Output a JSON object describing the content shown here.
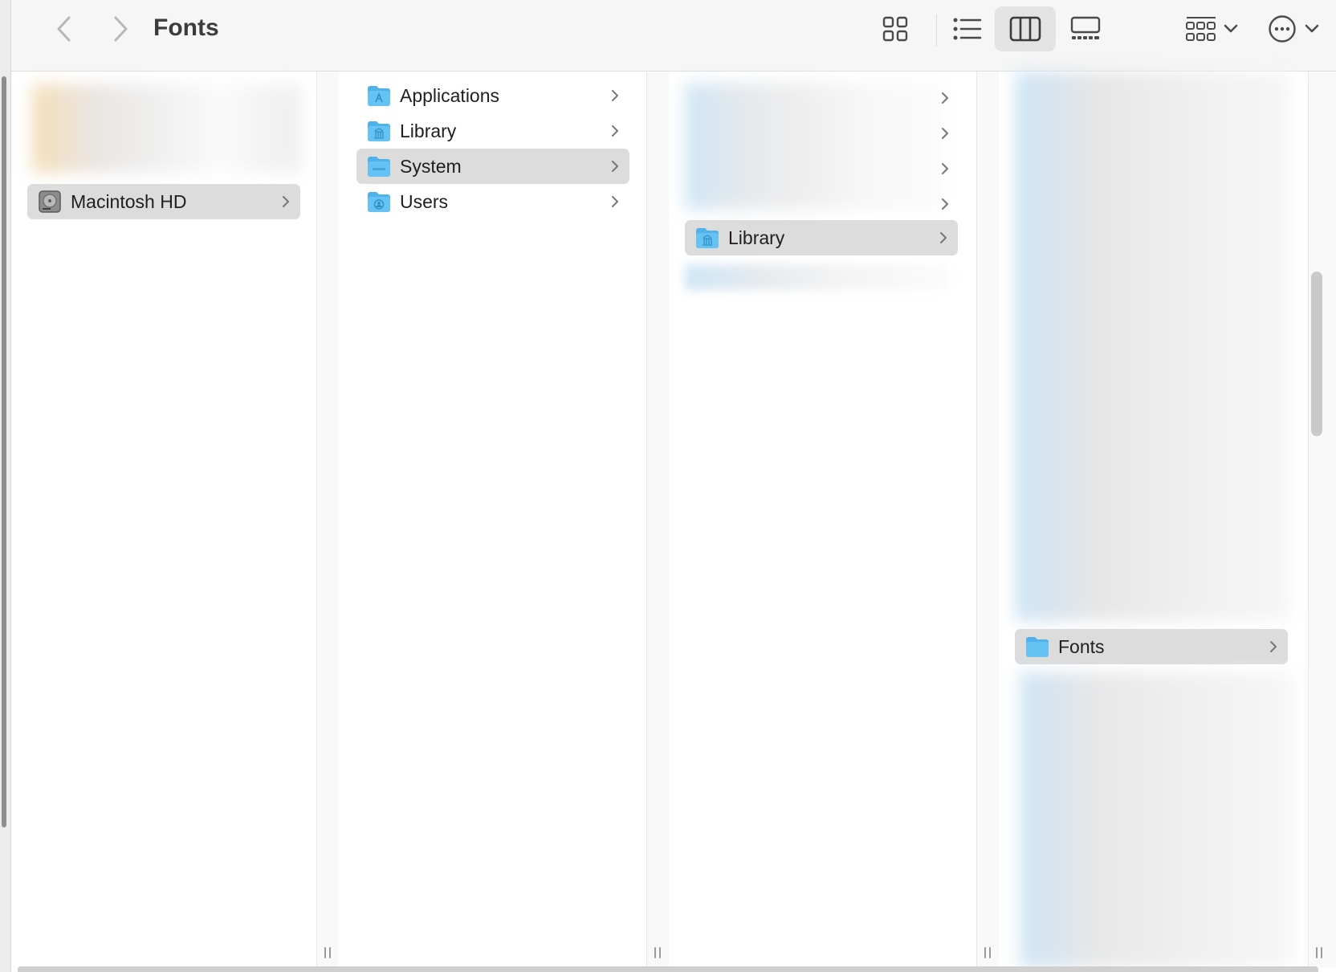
{
  "window": {
    "title": "Fonts"
  },
  "toolbar": {
    "back_icon": "chevron-left-icon",
    "forward_icon": "chevron-right-icon",
    "views": [
      "icon-view-icon",
      "list-view-icon",
      "column-view-icon",
      "gallery-view-icon"
    ],
    "selected_view": "column-view-icon",
    "group_icon": "group-by-icon",
    "more_icon": "ellipsis-circle-icon"
  },
  "columns": [
    {
      "items": [
        {
          "label": "Macintosh HD",
          "selected": true,
          "icon": "hard-drive-icon"
        }
      ]
    },
    {
      "items": [
        {
          "label": "Applications",
          "selected": false,
          "icon": "applications-folder-icon"
        },
        {
          "label": "Library",
          "selected": false,
          "icon": "library-folder-icon"
        },
        {
          "label": "System",
          "selected": true,
          "icon": "system-folder-icon"
        },
        {
          "label": "Users",
          "selected": false,
          "icon": "users-folder-icon"
        }
      ]
    },
    {
      "items": [
        {
          "label": "Library",
          "selected": true,
          "icon": "library-folder-icon"
        }
      ]
    },
    {
      "items": [
        {
          "label": "Fonts",
          "selected": true,
          "icon": "folder-icon"
        }
      ]
    }
  ],
  "colors": {
    "folder_blue": "#4fb2ea",
    "selection_gray": "#dcdcdc",
    "toolbar_bg": "#f6f6f6"
  }
}
